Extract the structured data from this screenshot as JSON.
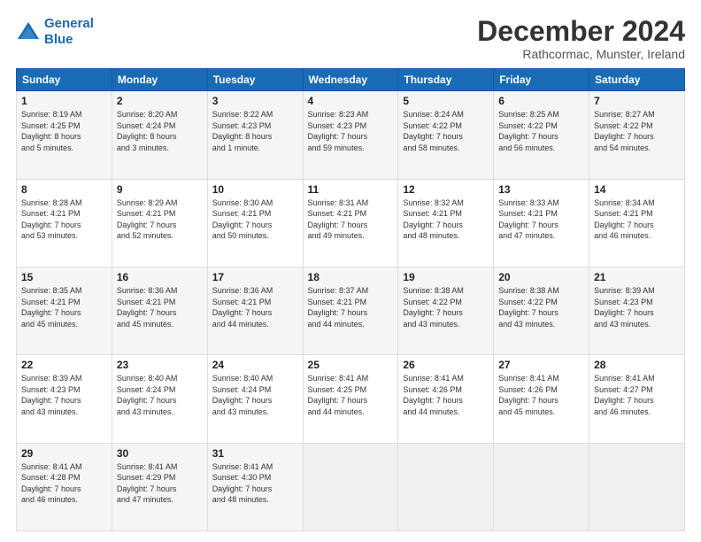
{
  "logo": {
    "line1": "General",
    "line2": "Blue"
  },
  "title": "December 2024",
  "subtitle": "Rathcormac, Munster, Ireland",
  "days_header": [
    "Sunday",
    "Monday",
    "Tuesday",
    "Wednesday",
    "Thursday",
    "Friday",
    "Saturday"
  ],
  "weeks": [
    [
      {
        "day": "1",
        "info": "Sunrise: 8:19 AM\nSunset: 4:25 PM\nDaylight: 8 hours\nand 5 minutes."
      },
      {
        "day": "2",
        "info": "Sunrise: 8:20 AM\nSunset: 4:24 PM\nDaylight: 8 hours\nand 3 minutes."
      },
      {
        "day": "3",
        "info": "Sunrise: 8:22 AM\nSunset: 4:23 PM\nDaylight: 8 hours\nand 1 minute."
      },
      {
        "day": "4",
        "info": "Sunrise: 8:23 AM\nSunset: 4:23 PM\nDaylight: 7 hours\nand 59 minutes."
      },
      {
        "day": "5",
        "info": "Sunrise: 8:24 AM\nSunset: 4:22 PM\nDaylight: 7 hours\nand 58 minutes."
      },
      {
        "day": "6",
        "info": "Sunrise: 8:25 AM\nSunset: 4:22 PM\nDaylight: 7 hours\nand 56 minutes."
      },
      {
        "day": "7",
        "info": "Sunrise: 8:27 AM\nSunset: 4:22 PM\nDaylight: 7 hours\nand 54 minutes."
      }
    ],
    [
      {
        "day": "8",
        "info": "Sunrise: 8:28 AM\nSunset: 4:21 PM\nDaylight: 7 hours\nand 53 minutes."
      },
      {
        "day": "9",
        "info": "Sunrise: 8:29 AM\nSunset: 4:21 PM\nDaylight: 7 hours\nand 52 minutes."
      },
      {
        "day": "10",
        "info": "Sunrise: 8:30 AM\nSunset: 4:21 PM\nDaylight: 7 hours\nand 50 minutes."
      },
      {
        "day": "11",
        "info": "Sunrise: 8:31 AM\nSunset: 4:21 PM\nDaylight: 7 hours\nand 49 minutes."
      },
      {
        "day": "12",
        "info": "Sunrise: 8:32 AM\nSunset: 4:21 PM\nDaylight: 7 hours\nand 48 minutes."
      },
      {
        "day": "13",
        "info": "Sunrise: 8:33 AM\nSunset: 4:21 PM\nDaylight: 7 hours\nand 47 minutes."
      },
      {
        "day": "14",
        "info": "Sunrise: 8:34 AM\nSunset: 4:21 PM\nDaylight: 7 hours\nand 46 minutes."
      }
    ],
    [
      {
        "day": "15",
        "info": "Sunrise: 8:35 AM\nSunset: 4:21 PM\nDaylight: 7 hours\nand 45 minutes."
      },
      {
        "day": "16",
        "info": "Sunrise: 8:36 AM\nSunset: 4:21 PM\nDaylight: 7 hours\nand 45 minutes."
      },
      {
        "day": "17",
        "info": "Sunrise: 8:36 AM\nSunset: 4:21 PM\nDaylight: 7 hours\nand 44 minutes."
      },
      {
        "day": "18",
        "info": "Sunrise: 8:37 AM\nSunset: 4:21 PM\nDaylight: 7 hours\nand 44 minutes."
      },
      {
        "day": "19",
        "info": "Sunrise: 8:38 AM\nSunset: 4:22 PM\nDaylight: 7 hours\nand 43 minutes."
      },
      {
        "day": "20",
        "info": "Sunrise: 8:38 AM\nSunset: 4:22 PM\nDaylight: 7 hours\nand 43 minutes."
      },
      {
        "day": "21",
        "info": "Sunrise: 8:39 AM\nSunset: 4:23 PM\nDaylight: 7 hours\nand 43 minutes."
      }
    ],
    [
      {
        "day": "22",
        "info": "Sunrise: 8:39 AM\nSunset: 4:23 PM\nDaylight: 7 hours\nand 43 minutes."
      },
      {
        "day": "23",
        "info": "Sunrise: 8:40 AM\nSunset: 4:24 PM\nDaylight: 7 hours\nand 43 minutes."
      },
      {
        "day": "24",
        "info": "Sunrise: 8:40 AM\nSunset: 4:24 PM\nDaylight: 7 hours\nand 43 minutes."
      },
      {
        "day": "25",
        "info": "Sunrise: 8:41 AM\nSunset: 4:25 PM\nDaylight: 7 hours\nand 44 minutes."
      },
      {
        "day": "26",
        "info": "Sunrise: 8:41 AM\nSunset: 4:26 PM\nDaylight: 7 hours\nand 44 minutes."
      },
      {
        "day": "27",
        "info": "Sunrise: 8:41 AM\nSunset: 4:26 PM\nDaylight: 7 hours\nand 45 minutes."
      },
      {
        "day": "28",
        "info": "Sunrise: 8:41 AM\nSunset: 4:27 PM\nDaylight: 7 hours\nand 46 minutes."
      }
    ],
    [
      {
        "day": "29",
        "info": "Sunrise: 8:41 AM\nSunset: 4:28 PM\nDaylight: 7 hours\nand 46 minutes."
      },
      {
        "day": "30",
        "info": "Sunrise: 8:41 AM\nSunset: 4:29 PM\nDaylight: 7 hours\nand 47 minutes."
      },
      {
        "day": "31",
        "info": "Sunrise: 8:41 AM\nSunset: 4:30 PM\nDaylight: 7 hours\nand 48 minutes."
      },
      null,
      null,
      null,
      null
    ]
  ]
}
